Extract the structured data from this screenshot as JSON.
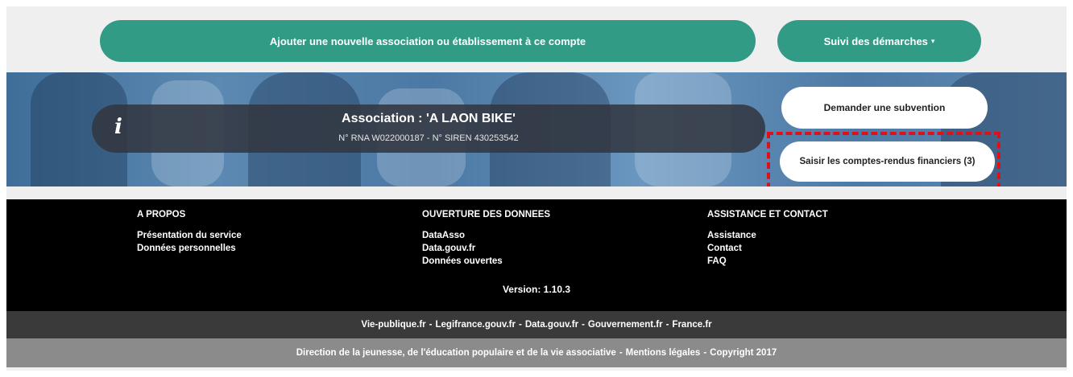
{
  "top_actions": {
    "add_association_label": "Ajouter une nouvelle association ou établissement à ce compte",
    "suivi_label": "Suivi des démarches",
    "suivi_caret": "▾"
  },
  "banner": {
    "info_icon": "i",
    "association_name": "Association : 'A LAON BIKE'",
    "association_ids": "N° RNA W022000187 - N° SIREN 430253542",
    "subvention_label": "Demander une subvention",
    "comptes_rendus_label": "Saisir les comptes-rendus financiers (3)"
  },
  "footer": {
    "apropos": {
      "heading": "A PROPOS",
      "links": [
        "Présentation du service",
        "Données personnelles"
      ]
    },
    "ouverture": {
      "heading": "OUVERTURE DES DONNEES",
      "links": [
        "DataAsso",
        "Data.gouv.fr",
        "Données ouvertes"
      ]
    },
    "assistance": {
      "heading": "ASSISTANCE ET CONTACT",
      "links": [
        "Assistance",
        "Contact",
        "FAQ"
      ]
    },
    "version": "Version: 1.10.3",
    "external_links": [
      "Vie-publique.fr",
      "Legifrance.gouv.fr",
      "Data.gouv.fr",
      "Gouvernement.fr",
      "France.fr"
    ],
    "legal": [
      "Direction de la jeunesse, de l'éducation populaire et de la vie associative",
      "Mentions légales",
      "Copyright 2017"
    ],
    "separator": "-"
  },
  "colors": {
    "primary_green": "#329b85",
    "highlight_red": "#e0101a",
    "footer_black": "#000000",
    "footer_dark_gray": "#3a3a3a",
    "footer_gray": "#8b8b8b"
  }
}
